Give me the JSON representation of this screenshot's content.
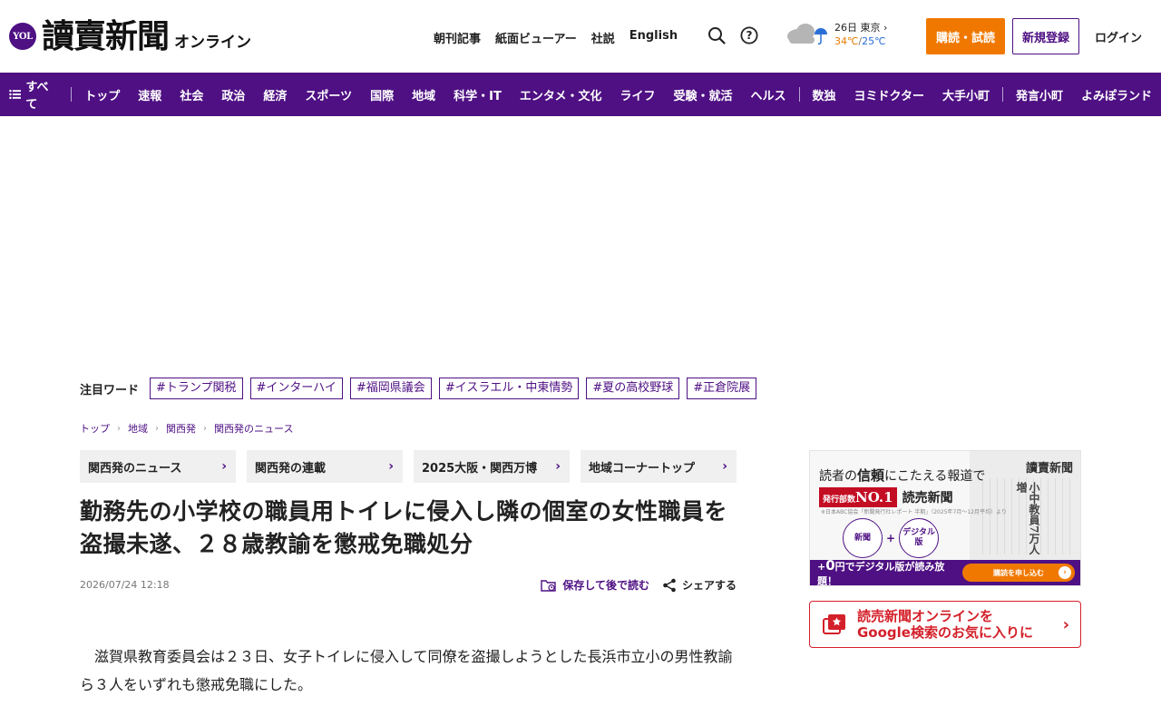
{
  "header": {
    "logo_badge": "YOL",
    "logo_text": "讀賣新聞",
    "logo_sub": "オンライン",
    "top_links": [
      "朝刊記事",
      "紙面ビューアー",
      "社説",
      "English"
    ],
    "weather": {
      "date": "26日",
      "city": "東京",
      "high": "34℃",
      "sep": "/",
      "low": "25℃"
    },
    "subscribe_label": "購読・試読",
    "register_label": "新規登録",
    "login_label": "ログイン"
  },
  "nav": {
    "all_label": "すべて",
    "items_main": [
      "トップ",
      "速報",
      "社会",
      "政治",
      "経済",
      "スポーツ",
      "国際",
      "地域",
      "科学・IT",
      "エンタメ・文化",
      "ライフ",
      "受験・就活",
      "ヘルス"
    ],
    "items_sub": [
      "数独",
      "ヨミドクター",
      "大手小町"
    ],
    "items_tail": [
      "発言小町",
      "よみぽランド"
    ]
  },
  "trend": {
    "label": "注目ワード",
    "tags": [
      "#トランプ関税",
      "#インターハイ",
      "#福岡県議会",
      "#イスラエル・中東情勢",
      "#夏の高校野球",
      "#正倉院展"
    ]
  },
  "breadcrumb": [
    "トップ",
    "地域",
    "関西発",
    "関西発のニュース"
  ],
  "sections": [
    "関西発のニュース",
    "関西発の連載",
    "2025大阪・関西万博",
    "地域コーナートップ"
  ],
  "article": {
    "headline": "勤務先の小学校の職員用トイレに侵入し隣の個室の女性職員を盗撮未遂、２８歳教諭を懲戒免職処分",
    "date": "2026/07/24 12:18",
    "save_label": "保存して後で読む",
    "share_label": "シェアする",
    "body": "滋賀県教育委員会は２３日、女子トイレに侵入して同僚を盗撮しようとした長浜市立小の男性教諭ら３人をいずれも懲戒免職にした。"
  },
  "promo": {
    "headline_pre": "読者の",
    "headline_bold": "信頼",
    "headline_post": "にこたえる報道で",
    "badge_small": "発行部数",
    "badge_big": "NO.1",
    "badge_text": "読売新聞",
    "note": "※日本ABC協会「新聞発行社レポート 半期」（2025年7月～12月平均）より",
    "circle1": "新聞",
    "plus": "+",
    "circle2_line1": "デジタル",
    "circle2_line2": "版",
    "paper_title": "讀賣新聞",
    "paper_headline": "小中教員7万人増",
    "bar_pre": "+",
    "bar_zero": "0",
    "bar_post": "円でデジタル版が読み放題！",
    "bar_button": "購読を申し込む",
    "bar_button_arrow": "›"
  },
  "google_card": {
    "line1": "読売新聞オンラインを",
    "line2": "Google検索のお気に入りに",
    "arrow": "›"
  },
  "colors": {
    "brand": "#4e1083",
    "accent": "#f07800",
    "alert": "#d4202a"
  }
}
